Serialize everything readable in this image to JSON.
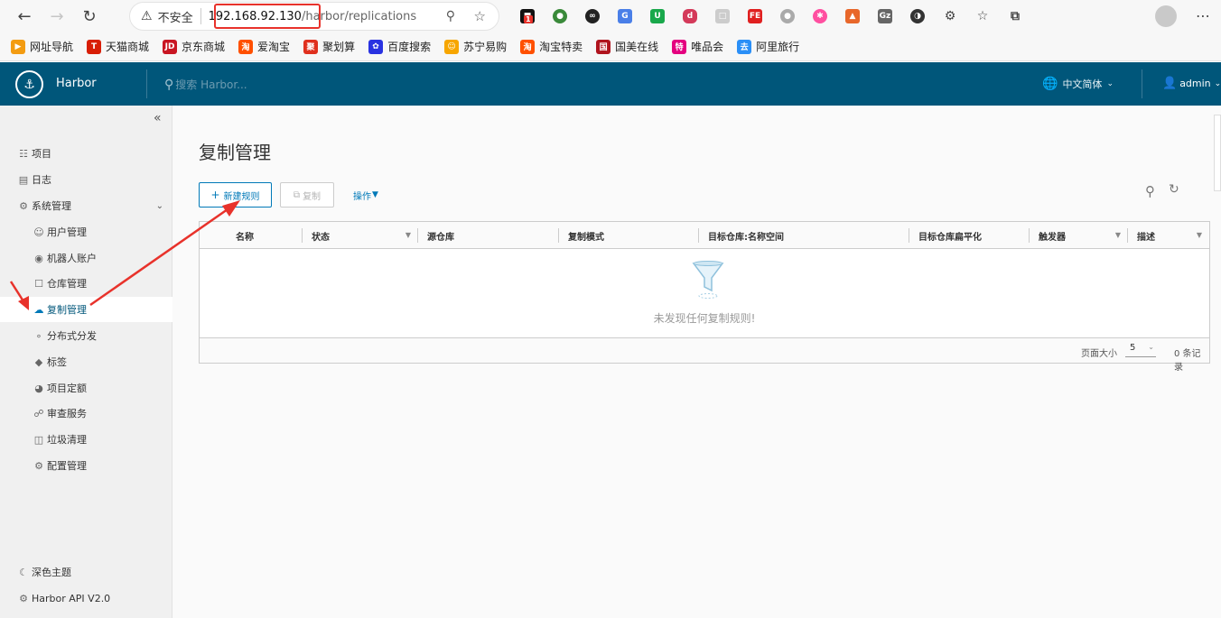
{
  "browser": {
    "insecure_label": "不安全",
    "url_host": "192.168.92.130",
    "url_path": "/harbor/replications",
    "extension_badge": "1",
    "bookmarks": [
      {
        "label": "网址导航",
        "color": "#f39c12"
      },
      {
        "label": "天猫商城",
        "color": "#d81e06"
      },
      {
        "label": "京东商城",
        "color": "#c91623"
      },
      {
        "label": "爱淘宝",
        "color": "#ff5000"
      },
      {
        "label": "聚划算",
        "color": "#e0301e"
      },
      {
        "label": "百度搜索",
        "color": "#2932e1"
      },
      {
        "label": "苏宁易购",
        "color": "#f7a600"
      },
      {
        "label": "淘宝特卖",
        "color": "#ff5000"
      },
      {
        "label": "国美在线",
        "color": "#b0141e"
      },
      {
        "label": "唯品会",
        "color": "#e4007f"
      },
      {
        "label": "阿里旅行",
        "color": "#2a8ff7"
      }
    ]
  },
  "header": {
    "brand": "Harbor",
    "search_placeholder": "搜索 Harbor...",
    "language": "中文简体",
    "user": "admin"
  },
  "sidebar": {
    "items": [
      {
        "label": "项目",
        "icon": "projects-icon"
      },
      {
        "label": "日志",
        "icon": "logs-icon"
      },
      {
        "label": "系统管理",
        "icon": "admin-icon"
      },
      {
        "label": "用户管理",
        "icon": "users-icon"
      },
      {
        "label": "机器人账户",
        "icon": "robot-icon"
      },
      {
        "label": "仓库管理",
        "icon": "registry-icon"
      },
      {
        "label": "复制管理",
        "icon": "replication-icon"
      },
      {
        "label": "分布式分发",
        "icon": "distribution-icon"
      },
      {
        "label": "标签",
        "icon": "tag-icon"
      },
      {
        "label": "项目定额",
        "icon": "quota-icon"
      },
      {
        "label": "审查服务",
        "icon": "shield-icon"
      },
      {
        "label": "垃圾清理",
        "icon": "trash-icon"
      },
      {
        "label": "配置管理",
        "icon": "gear-icon"
      }
    ],
    "dark_theme": "深色主题",
    "api": "Harbor API V2.0"
  },
  "main": {
    "title": "复制管理",
    "new_rule": "新建规则",
    "copy": "复制",
    "actions": "操作",
    "columns": [
      "名称",
      "状态",
      "源仓库",
      "复制模式",
      "目标仓库:名称空间",
      "目标仓库扁平化",
      "触发器",
      "描述"
    ],
    "empty_message": "未发现任何复制规则!",
    "page_size_label": "页面大小",
    "page_size": "5",
    "total": "0 条记录"
  },
  "colors": {
    "header": "#00567a",
    "accent": "#0079b8",
    "annotation": "#e8322b"
  }
}
